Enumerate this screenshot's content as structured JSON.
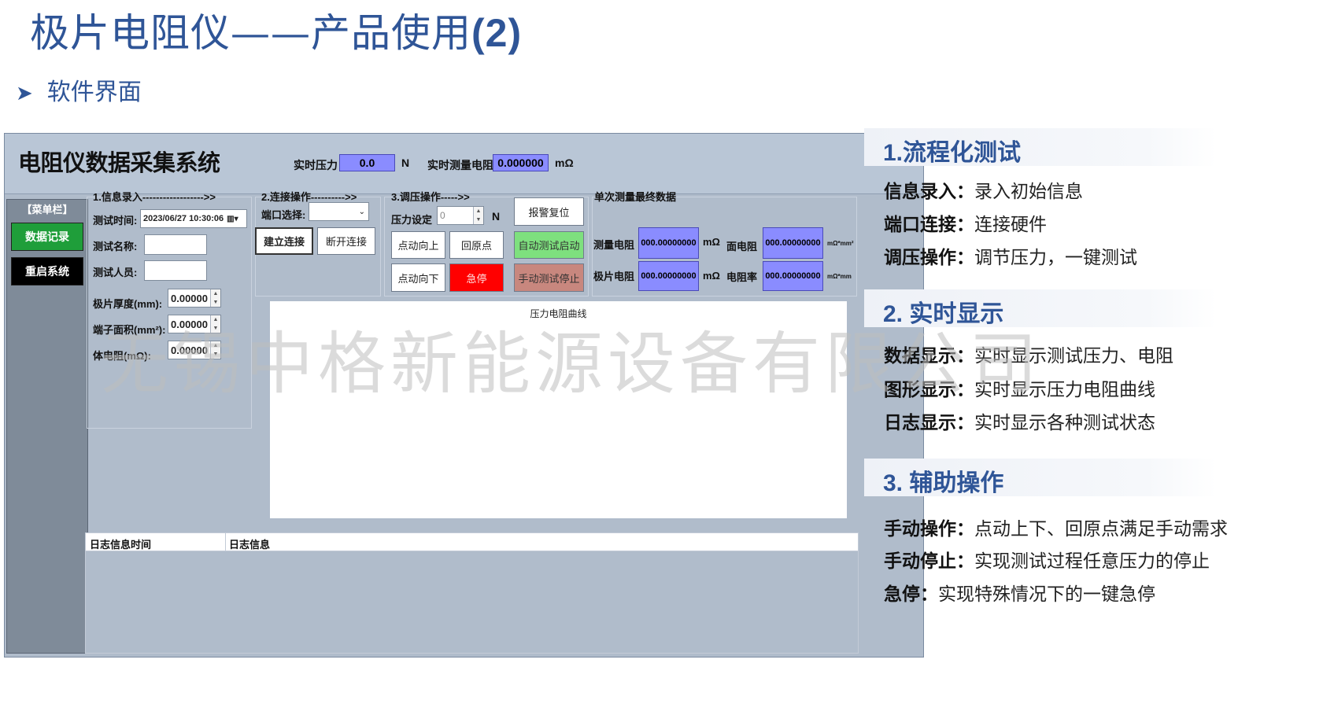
{
  "page": {
    "title_main": "极片电阻仪——产品使用",
    "title_num": "(2)",
    "subheading": "软件界面"
  },
  "app": {
    "title": "电阻仪数据采集系统",
    "realtime_pressure_label": "实时压力",
    "realtime_pressure_value": "0.0",
    "realtime_pressure_unit": "N",
    "realtime_resistance_label": "实时测量电阻",
    "realtime_resistance_value": "0.000000",
    "realtime_resistance_unit": "mΩ",
    "menu_label": "【菜单栏】",
    "menu_items": [
      "数据记录",
      "重启系统"
    ],
    "info": {
      "title": "1.信息录入------------------>>",
      "time_label": "测试时间:",
      "time_value": "2023/06/27 10:30:06",
      "name_label": "测试名称:",
      "name_value": "",
      "person_label": "测试人员:",
      "person_value": "",
      "thickness_label": "极片厚度(mm):",
      "thickness_value": "0.00000",
      "area_label": "端子面积(mm²):",
      "area_value": "0.00000",
      "bulk_label": "体电阻(mΩ):",
      "bulk_value": "0.00000"
    },
    "connect": {
      "title": "2.连接操作---------->>",
      "port_label": "端口选择:",
      "port_value": "",
      "connect_btn": "建立连接",
      "disconnect_btn": "断开连接"
    },
    "pressure": {
      "title": "3.调压操作----->>",
      "set_label": "压力设定",
      "set_value": "0",
      "set_unit": "N",
      "alarm_reset": "报警复位",
      "up": "点动向上",
      "origin": "回原点",
      "auto_start": "自动测试启动",
      "down": "点动向下",
      "estop": "急停",
      "manual_stop": "手动测试停止"
    },
    "results": {
      "title": "单次测量最终数据",
      "measured_label": "测量电阻",
      "measured_value": "000.00000000",
      "measured_unit": "mΩ",
      "surface_label": "面电阻",
      "surface_value": "000.00000000",
      "surface_unit": "mΩ*mm²",
      "sheet_label": "极片电阻",
      "sheet_value": "000.00000000",
      "sheet_unit": "mΩ",
      "resistivity_label": "电阻率",
      "resistivity_value": "000.00000000",
      "resistivity_unit": "mΩ*mm"
    },
    "chart_title": "压力电阻曲线",
    "log": {
      "col_time": "日志信息时间",
      "col_info": "日志信息"
    }
  },
  "watermark": "无锡中格新能源设备有限公司",
  "features": [
    {
      "heading": "1.流程化测试",
      "items": [
        {
          "key": "信息录入",
          "sep": "：",
          "text": "录入初始信息"
        },
        {
          "key": "端口连接",
          "sep": "：",
          "text": "连接硬件"
        },
        {
          "key": "调压操作",
          "sep": "：",
          "text": "调节压力，一键测试"
        }
      ]
    },
    {
      "heading": "2. 实时显示",
      "items": [
        {
          "key": "数据显示",
          "sep": "：",
          "text": "实时显示测试压力、电阻"
        },
        {
          "key": "图形显示",
          "sep": "：",
          "text": "实时显示压力电阻曲线"
        },
        {
          "key": "日志显示",
          "sep": "：",
          "text": "实时显示各种测试状态"
        }
      ]
    },
    {
      "heading": "3. 辅助操作",
      "items": [
        {
          "key": "手动操作",
          "sep": "：",
          "text": "点动上下、回原点满足手动需求"
        },
        {
          "key": "手动停止",
          "sep": "：",
          "text": "实现测试过程任意压力的停止"
        },
        {
          "key": "急停",
          "sep": "：",
          "text": "实现特殊情况下的一键急停"
        }
      ]
    }
  ],
  "colors": {
    "accent": "#2f5597",
    "menu_active": "#1f9e3a",
    "menu_dark": "#000000",
    "value_box": "#8a8cff",
    "auto_start": "#7ee07e",
    "estop": "#ff0000",
    "manual_stop": "#c8877e"
  }
}
